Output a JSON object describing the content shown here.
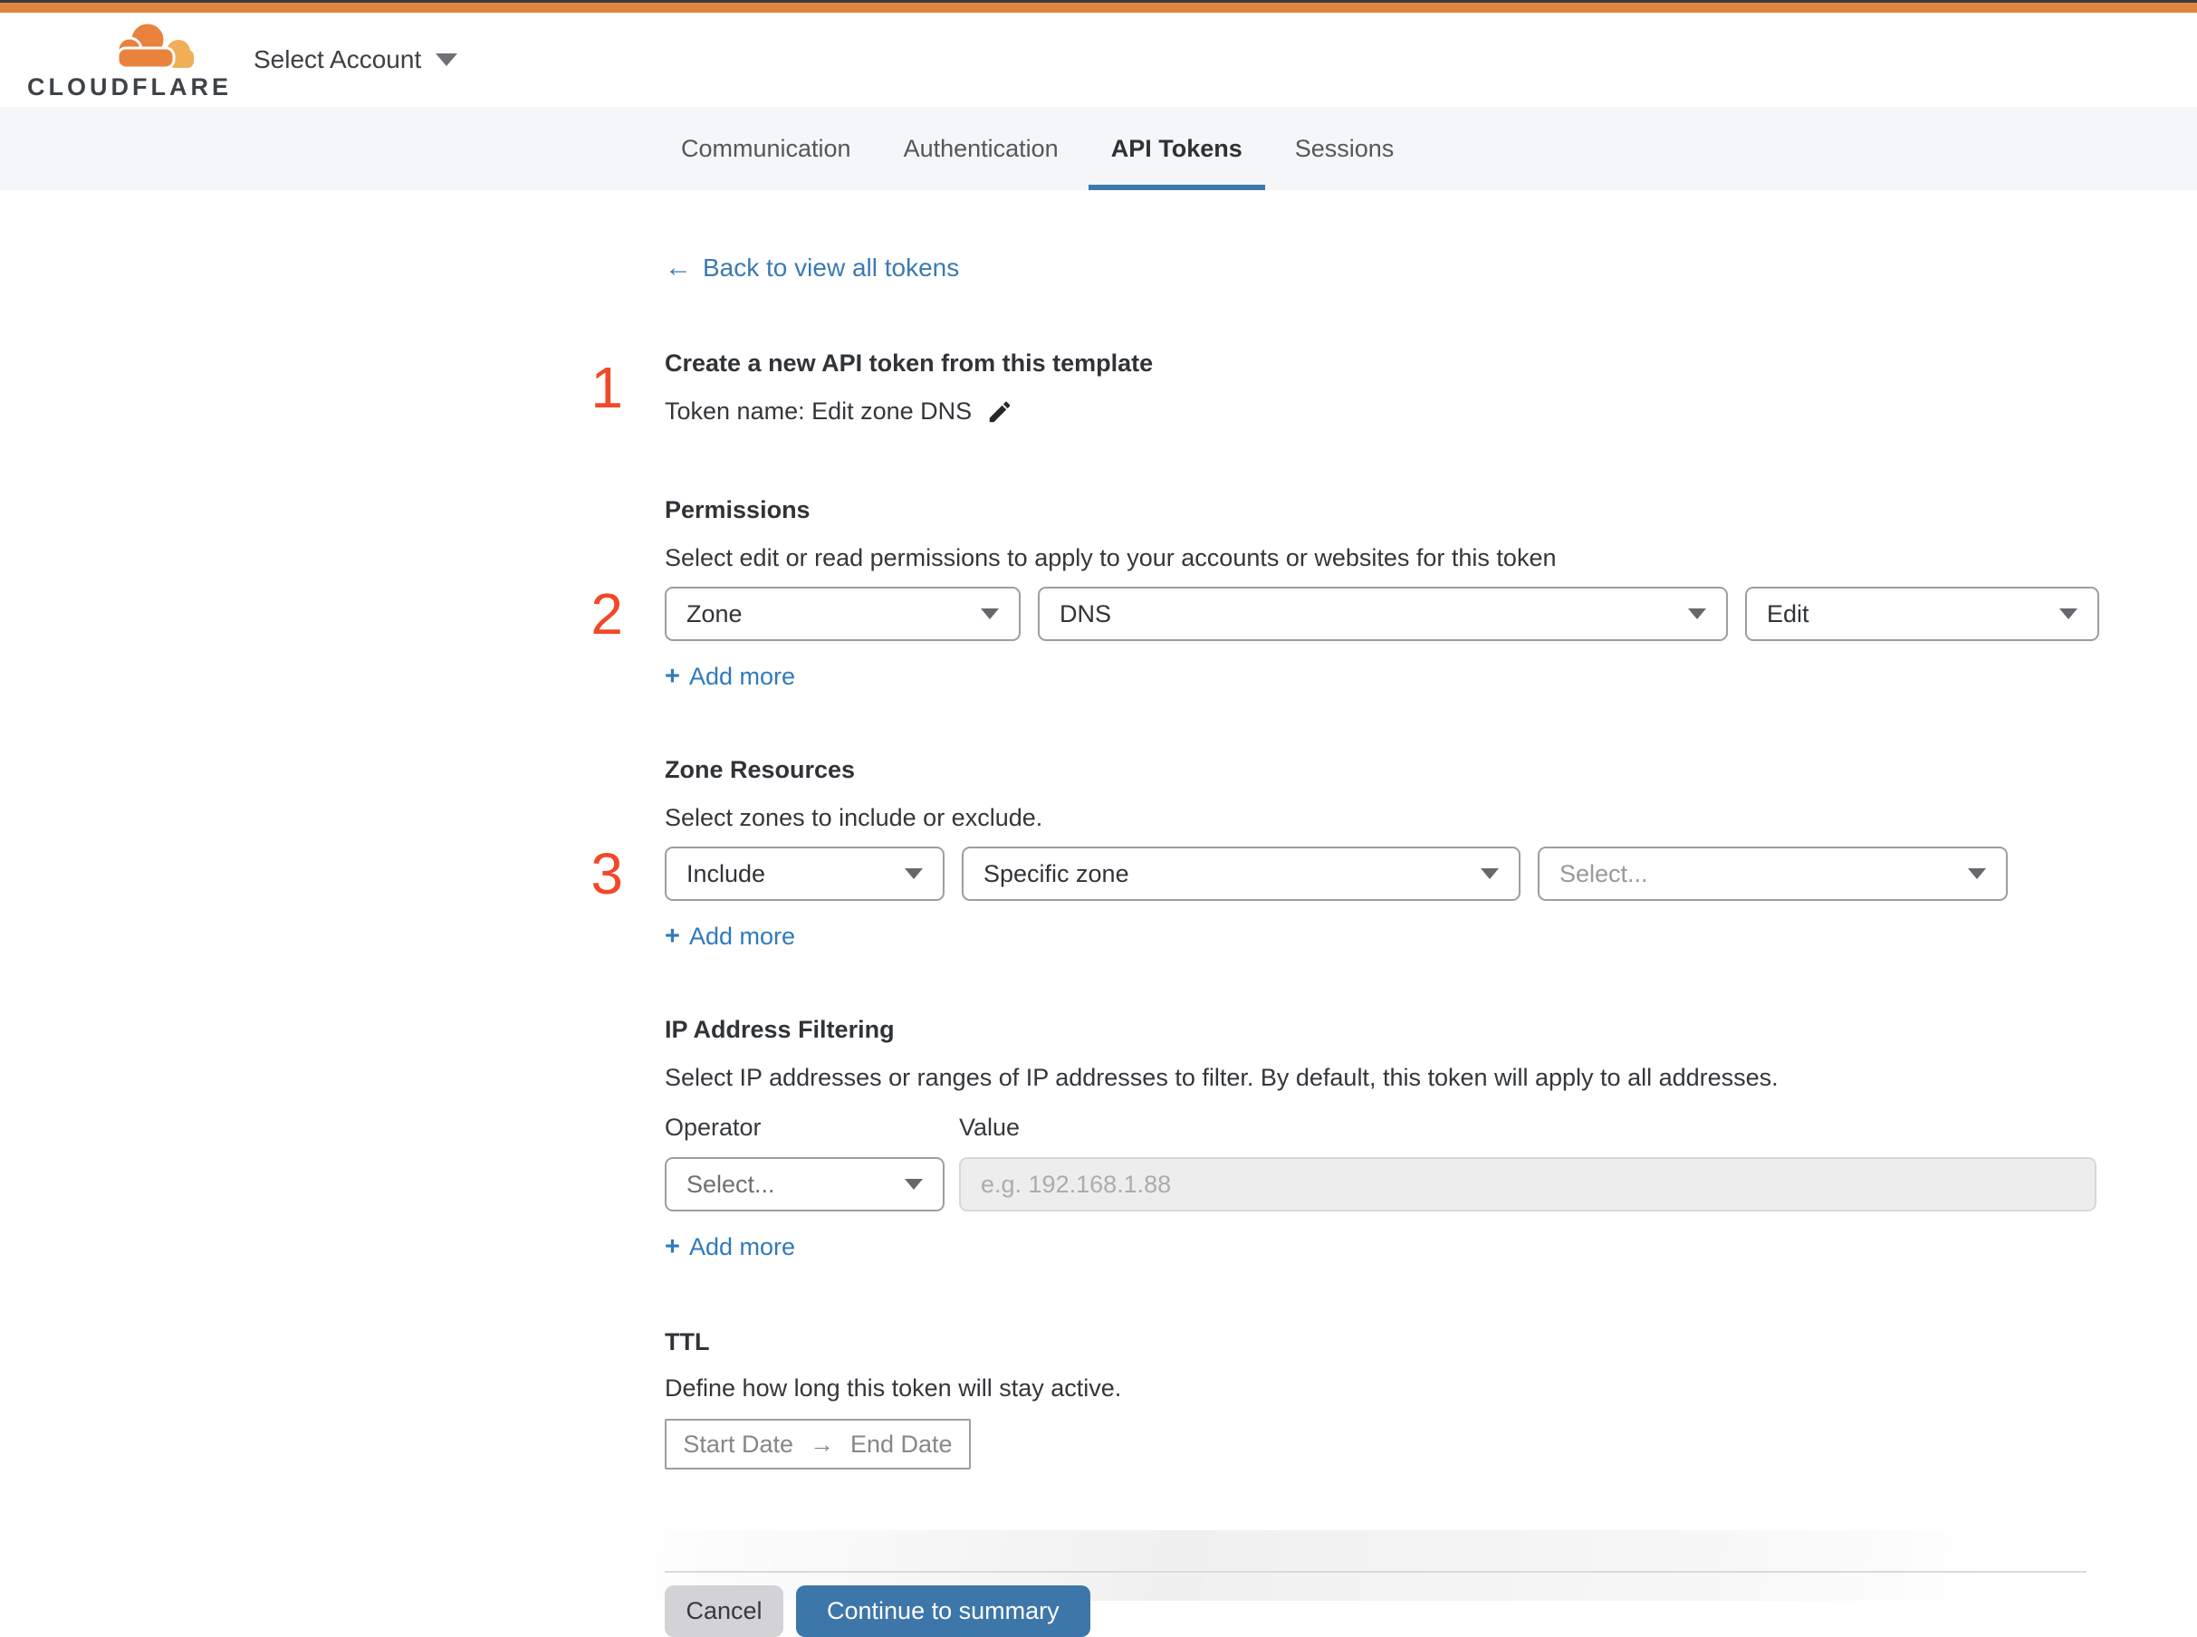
{
  "colors": {
    "accent_orange": "#df873e",
    "link_blue": "#2f7abc",
    "active_tab_blue": "#3e79ab",
    "step_red": "#f2482a",
    "button_blue": "#3d76a8"
  },
  "header": {
    "logo_text": "CLOUDFLARE",
    "account_selector": "Select Account"
  },
  "tabs": [
    {
      "label": "Communication"
    },
    {
      "label": "Authentication"
    },
    {
      "label": "API Tokens"
    },
    {
      "label": "Sessions"
    }
  ],
  "back_link": {
    "arrow": "←",
    "label": "Back to view all tokens"
  },
  "steps": {
    "one": "1",
    "two": "2",
    "three": "3"
  },
  "intro": {
    "title": "Create a new API token from this template",
    "token_name": "Token name: Edit zone DNS"
  },
  "permissions": {
    "heading": "Permissions",
    "description": "Select edit or read permissions to apply to your accounts or websites for this token",
    "selects": [
      {
        "value": "Zone"
      },
      {
        "value": "DNS"
      },
      {
        "value": "Edit"
      }
    ],
    "add_more": "Add more"
  },
  "zone_resources": {
    "heading": "Zone Resources",
    "description": "Select zones to include or exclude.",
    "selects": [
      {
        "value": "Include"
      },
      {
        "value": "Specific zone"
      },
      {
        "value": "Select..."
      }
    ],
    "add_more": "Add more"
  },
  "ip_filtering": {
    "heading": "IP Address Filtering",
    "description": "Select IP addresses or ranges of IP addresses to filter. By default, this token will apply to all addresses.",
    "operator_label": "Operator",
    "value_label": "Value",
    "operator_value": "Select...",
    "value_placeholder": "e.g. 192.168.1.88",
    "add_more": "Add more"
  },
  "ttl": {
    "heading": "TTL",
    "description": "Define how long this token will stay active.",
    "start_label": "Start Date",
    "range_arrow": "→",
    "end_label": "End Date"
  },
  "footer": {
    "cancel": "Cancel",
    "continue": "Continue to summary"
  },
  "icons": {
    "plus": "+"
  }
}
